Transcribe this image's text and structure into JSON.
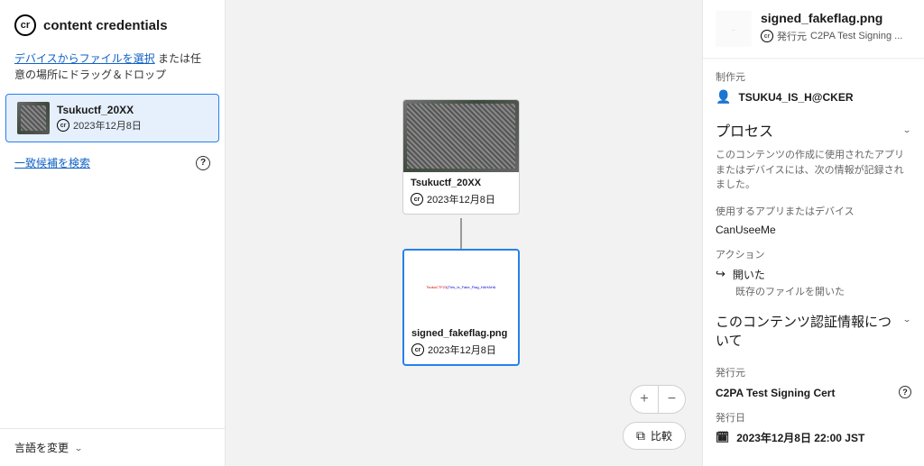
{
  "brand": "content credentials",
  "sidebar": {
    "file_select_link": "デバイスからファイルを選択",
    "file_select_suffix": " または任意の場所にドラッグ＆ドロップ",
    "files": [
      {
        "name": "Tsukuctf_20XX",
        "date": "2023年12月8日"
      }
    ],
    "search_link": "一致候補を検索",
    "language_label": "言語を変更"
  },
  "canvas": {
    "parent_card": {
      "title": "Tsukuctf_20XX",
      "date": "2023年12月8日"
    },
    "child_card": {
      "title": "signed_fakeflag.png",
      "date": "2023年12月8日",
      "thumb_text_prefix": "TsukuCTF23",
      "thumb_text_suffix": "{This_Is_Fake_Flag_HAHAHA"
    },
    "compare_label": "比較"
  },
  "details": {
    "title": "signed_fakeflag.png",
    "issuer_prefix": "発行元",
    "issuer_short": "C2PA Test Signing ...",
    "producer_label": "制作元",
    "producer": "TSUKU4_IS_H@CKER",
    "process_heading": "プロセス",
    "process_desc": "このコンテンツの作成に使用されたアプリまたはデバイスには、次の情報が記録されました。",
    "app_label": "使用するアプリまたはデバイス",
    "app_name": "CanUseeMe",
    "action_label": "アクション",
    "action_name": "開いた",
    "action_desc": "既存のファイルを開いた",
    "about_heading": "このコンテンツ認証情報について",
    "issuer_label": "発行元",
    "issuer_full": "C2PA Test Signing Cert",
    "issue_date_label": "発行日",
    "issue_date": "2023年12月8日 22:00 JST"
  }
}
